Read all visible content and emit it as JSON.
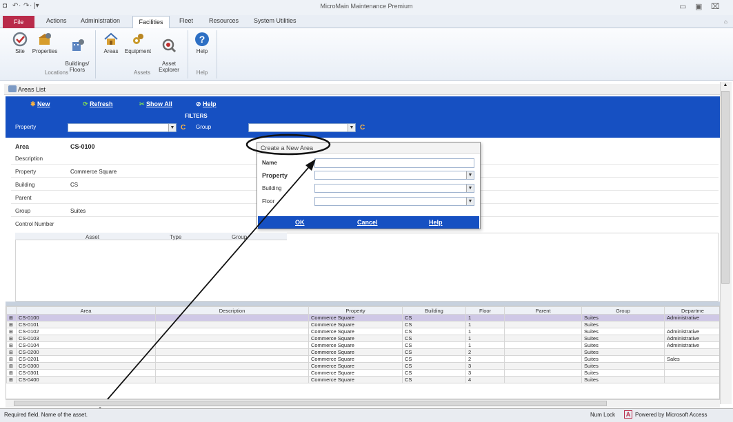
{
  "app_title": "MicroMain Maintenance Premium",
  "quick_access": [
    "◘",
    "↶",
    "·",
    "↷",
    "·",
    "|▾"
  ],
  "window_controls": [
    "▭",
    "▣",
    "⌧"
  ],
  "ribbon_tabs": [
    "File",
    "Actions",
    "Administration",
    "Facilities",
    "Fleet",
    "Resources",
    "System Utilities"
  ],
  "ribbon": {
    "buttons": [
      {
        "label": "Site",
        "icon": "site-icon",
        "color": "#6f7b87"
      },
      {
        "label": "Properties",
        "icon": "properties-icon",
        "color": "#d79d2c"
      },
      {
        "label": "Buildings/\nFloors",
        "icon": "buildings-icon",
        "color": "#5d86c2"
      },
      {
        "label": "Areas",
        "icon": "areas-icon",
        "color": "#d9a034"
      },
      {
        "label": "Equipment",
        "icon": "equipment-icon",
        "color": "#c99a2a"
      },
      {
        "label": "Asset\nExplorer",
        "icon": "asset-explorer-icon",
        "color": "#6b6b6b"
      },
      {
        "label": "Help",
        "icon": "help-icon",
        "color": "#2d6fc4"
      }
    ],
    "groups": [
      "Locations",
      "Assets",
      "Help"
    ]
  },
  "form_title": "Areas List",
  "toolbar": {
    "new": "New",
    "refresh": "Refresh",
    "show_all": "Show All",
    "help": "Help"
  },
  "filters": {
    "title": "FILTERS",
    "property_label": "Property",
    "group_label": "Group",
    "clear": "C"
  },
  "detail": {
    "area_label": "Area",
    "area_value": "CS-0100",
    "labels": [
      "Description",
      "Property",
      "Building",
      "Parent",
      "Group",
      "Control Number"
    ],
    "values": [
      "",
      "Commerce Square",
      "CS",
      "",
      "Suites",
      ""
    ]
  },
  "asset_grid_headers": [
    "Asset",
    "Type",
    "Group"
  ],
  "grid": {
    "headers": [
      "Area",
      "Description",
      "Property",
      "Building",
      "Floor",
      "Parent",
      "Group",
      "Departme"
    ],
    "rows": [
      [
        "CS-0100",
        "",
        "Commerce Square",
        "CS",
        "1",
        "",
        "Suites",
        "Administrative"
      ],
      [
        "CS-0101",
        "",
        "Commerce Square",
        "CS",
        "1",
        "",
        "Suites",
        ""
      ],
      [
        "CS-0102",
        "",
        "Commerce Square",
        "CS",
        "1",
        "",
        "Suites",
        "Administrative"
      ],
      [
        "CS-0103",
        "",
        "Commerce Square",
        "CS",
        "1",
        "",
        "Suites",
        "Administrative"
      ],
      [
        "CS-0104",
        "",
        "Commerce Square",
        "CS",
        "1",
        "",
        "Suites",
        "Administrative"
      ],
      [
        "CS-0200",
        "",
        "Commerce Square",
        "CS",
        "2",
        "",
        "Suites",
        ""
      ],
      [
        "CS-0201",
        "",
        "Commerce Square",
        "CS",
        "2",
        "",
        "Suites",
        "Sales"
      ],
      [
        "CS-0300",
        "",
        "Commerce Square",
        "CS",
        "3",
        "",
        "Suites",
        ""
      ],
      [
        "CS-0301",
        "",
        "Commerce Square",
        "CS",
        "3",
        "",
        "Suites",
        ""
      ],
      [
        "CS-0400",
        "",
        "Commerce Square",
        "CS",
        "4",
        "",
        "Suites",
        ""
      ]
    ]
  },
  "dialog": {
    "title": "Create a New Area",
    "labels": [
      "Name",
      "Property",
      "Building",
      "Floor"
    ],
    "ok": "OK",
    "cancel": "Cancel",
    "help": "Help"
  },
  "status": {
    "message": "Required field. Name of the asset.",
    "numlock": "Num Lock",
    "powered": "Powered by Microsoft Access"
  },
  "colors": {
    "accent": "#1650c2",
    "file_tab": "#b92b4a",
    "selected_row": "#cfc8e6"
  }
}
